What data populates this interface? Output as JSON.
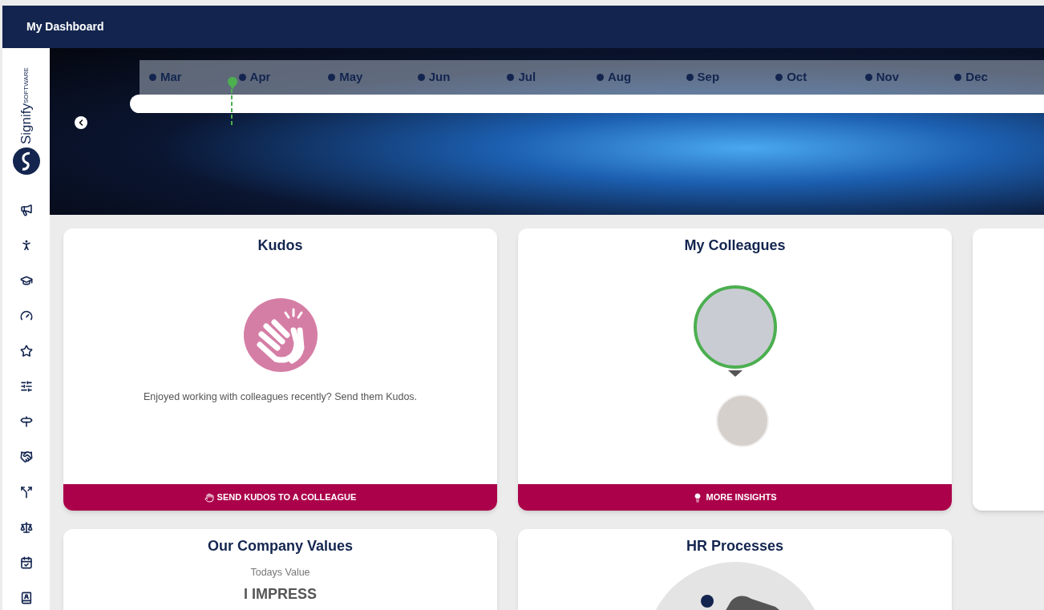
{
  "header": {
    "title": "My Dashboard"
  },
  "logo": {
    "name": "Signify",
    "tagline": "SOFTWARE"
  },
  "timeline": {
    "months": [
      "Mar",
      "Apr",
      "May",
      "Jun",
      "Jul",
      "Aug",
      "Sep",
      "Oct",
      "Nov",
      "Dec"
    ]
  },
  "kudos": {
    "title": "Kudos",
    "message": "Enjoyed working with colleagues recently? Send them Kudos.",
    "button": "SEND KUDOS TO A COLLEAGUE"
  },
  "colleagues": {
    "title": "My Colleagues",
    "people": [
      {
        "selected": true
      },
      {
        "selected": false
      }
    ],
    "button": "MORE INSIGHTS"
  },
  "values": {
    "title": "Our Company Values",
    "caption": "Todays Value",
    "value": "I IMPRESS"
  },
  "hr": {
    "title": "HR Processes"
  }
}
